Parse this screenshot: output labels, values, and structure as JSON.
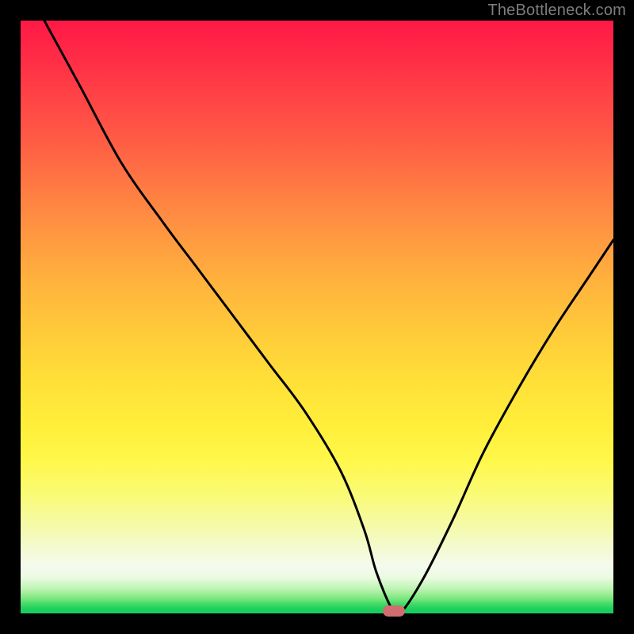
{
  "watermark": "TheBottleneck.com",
  "marker_color": "#d16d70",
  "chart_data": {
    "type": "line",
    "title": "",
    "xlabel": "",
    "ylabel": "",
    "xlim": [
      0,
      100
    ],
    "ylim": [
      0,
      100
    ],
    "x": [
      4,
      10,
      17,
      24,
      30,
      36,
      42,
      48,
      54,
      58,
      60,
      62.5,
      64,
      68,
      73,
      78,
      84,
      90,
      96,
      100
    ],
    "values": [
      100,
      89,
      76,
      66,
      58,
      50,
      42,
      34,
      24,
      14,
      7,
      1,
      0,
      6,
      16,
      27,
      38,
      48,
      57,
      63
    ],
    "minimum_marker": {
      "x": 63,
      "y": 0
    },
    "background_gradient_stops": [
      {
        "pos": 0,
        "color": "#ff1946"
      },
      {
        "pos": 50,
        "color": "#ffc93a"
      },
      {
        "pos": 92,
        "color": "#f4faee"
      },
      {
        "pos": 100,
        "color": "#17cd5e"
      }
    ]
  }
}
